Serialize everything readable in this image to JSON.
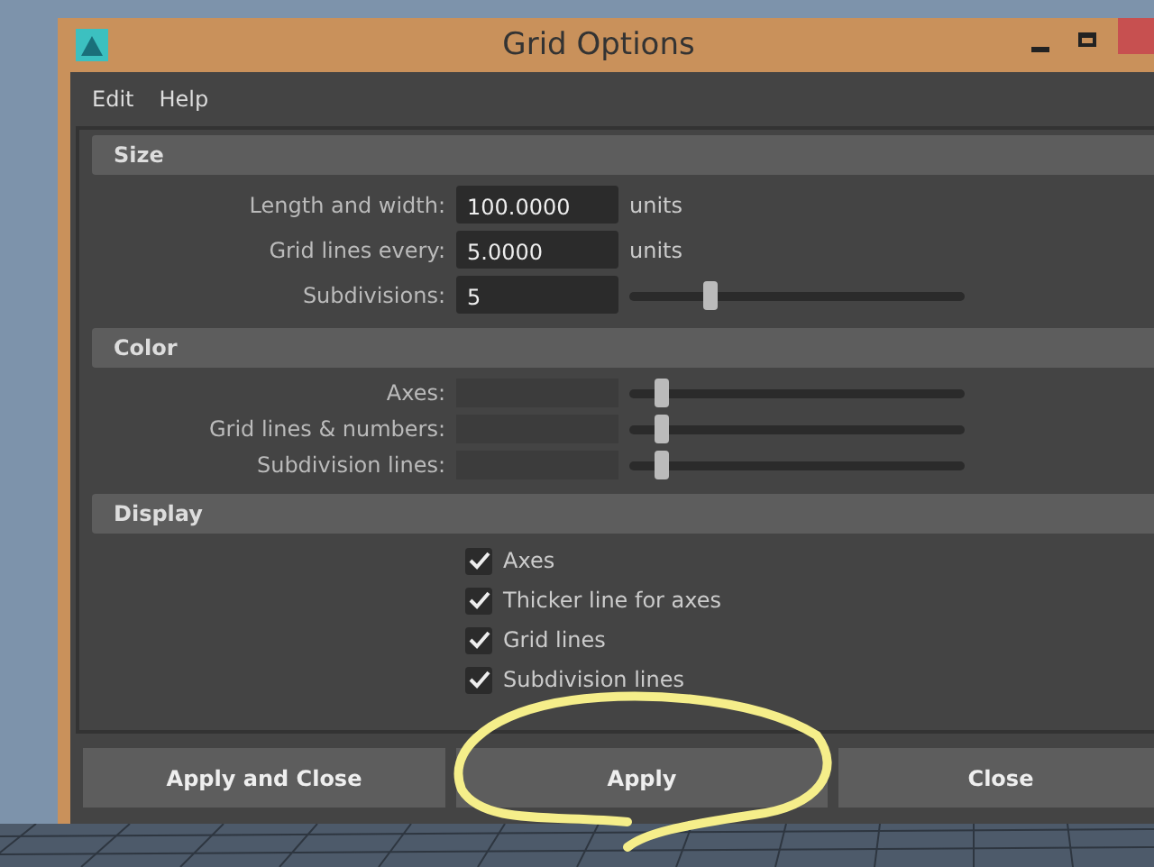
{
  "window": {
    "title": "Grid Options"
  },
  "menu": [
    "Edit",
    "Help"
  ],
  "sections": [
    {
      "title": "Size",
      "rows": [
        {
          "kind": "field",
          "label": "Length and width:",
          "value": "100.0000",
          "unit": "units"
        },
        {
          "kind": "field",
          "label": "Grid lines every:",
          "value": "5.0000",
          "unit": "units"
        },
        {
          "kind": "slider",
          "label": "Subdivisions:",
          "value": "5",
          "level": 0.23
        }
      ]
    },
    {
      "title": "Color",
      "rows": [
        {
          "kind": "color",
          "label": "Axes:",
          "level": 0.08
        },
        {
          "kind": "color",
          "label": "Grid lines & numbers:",
          "level": 0.08
        },
        {
          "kind": "color",
          "label": "Subdivision lines:",
          "level": 0.08
        }
      ]
    },
    {
      "title": "Display",
      "rows": [
        {
          "kind": "check",
          "label": "Axes",
          "checked": true
        },
        {
          "kind": "check",
          "label": "Thicker line for axes",
          "checked": true
        },
        {
          "kind": "check",
          "label": "Grid lines",
          "checked": true
        },
        {
          "kind": "check",
          "label": "Subdivision lines",
          "checked": true
        }
      ]
    }
  ],
  "buttons": [
    "Apply and Close",
    "Apply",
    "Close"
  ]
}
